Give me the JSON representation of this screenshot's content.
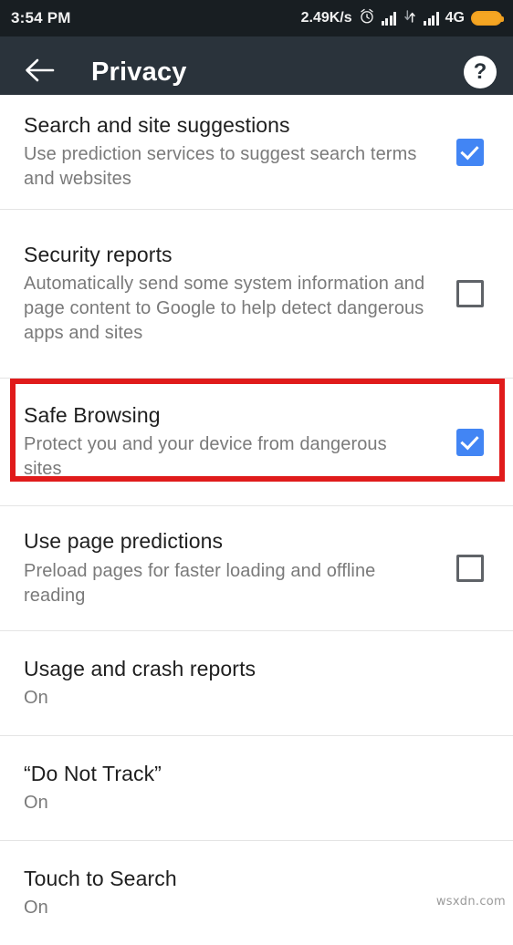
{
  "status_bar": {
    "clock": "3:54 PM",
    "network_speed": "2.49K/s",
    "network_type": "4G",
    "icons": [
      "alarm-icon",
      "signal-bars-icon",
      "data-transfer-icon",
      "signal-bars-icon",
      "battery-icon"
    ]
  },
  "app_bar": {
    "back_label": "",
    "title": "Privacy",
    "help_label": "?"
  },
  "settings": [
    {
      "title": "Search and site suggestions",
      "subtitle": "Use prediction services to suggest search terms and websites",
      "control": "checkbox",
      "checked": true,
      "highlighted": false
    },
    {
      "title": "Security reports",
      "subtitle": "Automatically send some system information and page content to Google to help detect dangerous apps and sites",
      "control": "checkbox",
      "checked": false,
      "highlighted": false
    },
    {
      "title": "Safe Browsing",
      "subtitle": "Protect you and your device from dangerous sites",
      "control": "checkbox",
      "checked": true,
      "highlighted": true
    },
    {
      "title": "Use page predictions",
      "subtitle": "Preload pages for faster loading and offline reading",
      "control": "checkbox",
      "checked": false,
      "highlighted": false
    },
    {
      "title": "Usage and crash reports",
      "subtitle": "On",
      "control": "none",
      "checked": null,
      "highlighted": false
    },
    {
      "title": "“Do Not Track”",
      "subtitle": "On",
      "control": "none",
      "checked": null,
      "highlighted": false
    },
    {
      "title": "Touch to Search",
      "subtitle": "On",
      "control": "none",
      "checked": null,
      "highlighted": false
    }
  ],
  "watermark": "wsxdn.com",
  "colors": {
    "status_bar_bg": "#181e22",
    "app_bar_bg": "#2a333b",
    "accent_checkbox": "#4285f4",
    "checkbox_off_border": "#5f6368",
    "highlight_border": "#e01b1b",
    "battery": "#f5a623",
    "title_text": "#1f1f1f",
    "subtitle_text": "#7a7a7a"
  }
}
